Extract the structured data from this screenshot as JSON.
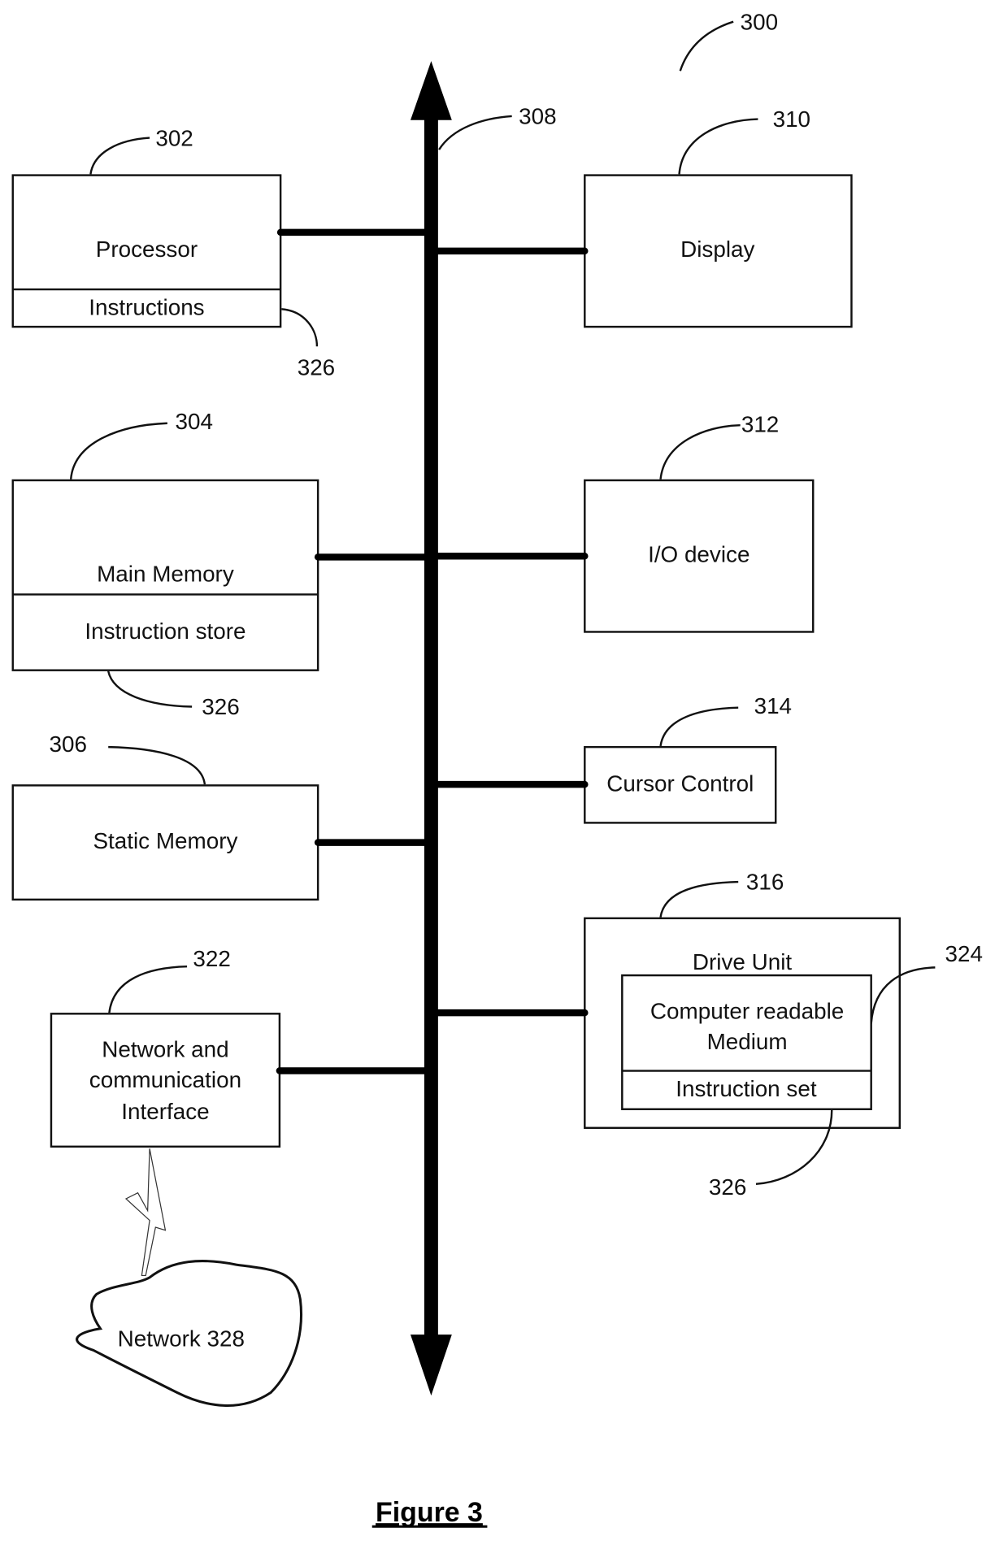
{
  "figure": {
    "caption": "Figure 3",
    "ref": "300"
  },
  "bus": {
    "ref": "308"
  },
  "left_blocks": [
    {
      "id": "processor",
      "ref": "302",
      "label": "Processor",
      "sub_label": "Instructions",
      "sub_ref": "326"
    },
    {
      "id": "main_memory",
      "ref": "304",
      "label": "Main Memory",
      "sub_label": "Instruction store",
      "sub_ref": "326"
    },
    {
      "id": "static_memory",
      "ref": "306",
      "label": "Static Memory"
    },
    {
      "id": "network_interface",
      "ref": "322",
      "label_lines": [
        "Network and",
        "communication",
        "Interface"
      ]
    }
  ],
  "right_blocks": [
    {
      "id": "display",
      "ref": "310",
      "label": "Display"
    },
    {
      "id": "io_device",
      "ref": "312",
      "label": "I/O device"
    },
    {
      "id": "cursor_control",
      "ref": "314",
      "label": "Cursor Control"
    },
    {
      "id": "drive_unit",
      "ref": "316",
      "label": "Drive Unit",
      "inner": {
        "ref": "324",
        "label_lines": [
          "Computer readable",
          "Medium"
        ],
        "sub_label": "Instruction set",
        "sub_ref": "326"
      }
    }
  ],
  "network": {
    "label": "Network 328"
  }
}
